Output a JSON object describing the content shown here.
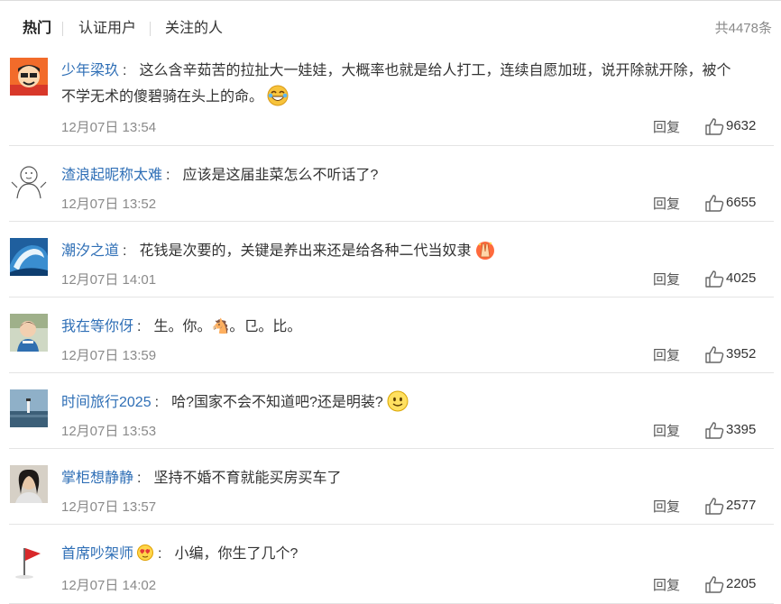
{
  "tabs": [
    {
      "label": "热门"
    },
    {
      "label": "认证用户"
    },
    {
      "label": "关注的人"
    }
  ],
  "total": "共4478条",
  "reply_label": "回复",
  "colors": {
    "username": "#2f6fb6",
    "meta": "#8a8a8a",
    "text": "#333333"
  },
  "comments": [
    {
      "user": "少年梁玖",
      "badge": "",
      "text": "这么含辛茹苦的拉扯大一娃娃，大概率也就是给人打工，连续自愿加班，说开除就开除，被个",
      "text2": "不学无术的傻碧骑在头上的命。",
      "emoji": "laughing-tears",
      "time": "12月07日 13:54",
      "likes": "9632",
      "avatar": "cartoon-man"
    },
    {
      "user": "渣浪起昵称太难",
      "badge": "",
      "text": "应该是这届韭菜怎么不听话了?",
      "text2": "",
      "emoji": "",
      "time": "12月07日 13:52",
      "likes": "6655",
      "avatar": "doodle-face"
    },
    {
      "user": "潮汐之道",
      "badge": "",
      "text": "花钱是次要的，关键是养出来还是给各种二代当奴隶",
      "text2": "",
      "emoji": "praying-hands",
      "time": "12月07日 14:01",
      "likes": "4025",
      "avatar": "wave"
    },
    {
      "user": "我在等你伢",
      "badge": "",
      "text": "生。你。🐴。㔾。比。",
      "text2": "",
      "emoji": "",
      "time": "12月07日 13:59",
      "likes": "3952",
      "avatar": "child"
    },
    {
      "user": "时间旅行2025",
      "badge": "",
      "text": "哈?国家不会不知道吧?还是明装?",
      "text2": "",
      "emoji": "smiley",
      "time": "12月07日 13:53",
      "likes": "3395",
      "avatar": "lighthouse"
    },
    {
      "user": "掌柜想静静",
      "badge": "",
      "text": "坚持不婚不育就能买房买车了",
      "text2": "",
      "emoji": "",
      "time": "12月07日 13:57",
      "likes": "2577",
      "avatar": "woman"
    },
    {
      "user": "首席吵架师",
      "badge": "crown-heart",
      "text": "小编，你生了几个?",
      "text2": "",
      "emoji": "",
      "time": "12月07日 14:02",
      "likes": "2205",
      "avatar": "red-flag"
    }
  ]
}
